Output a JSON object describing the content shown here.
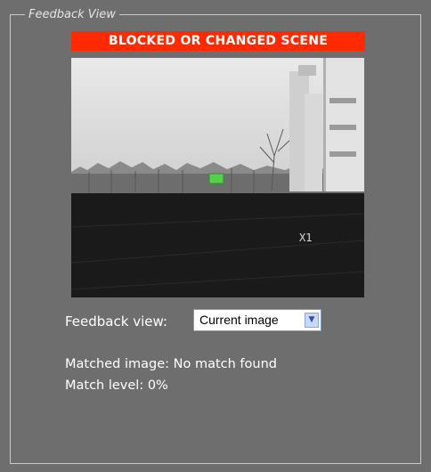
{
  "panel": {
    "legend": "Feedback View",
    "banner": "BLOCKED OR CHANGED SCENE",
    "camera_overlay": "X1",
    "feedback_view_label": "Feedback view:",
    "feedback_view_selected": "Current image",
    "matched_image_label": "Matched image:",
    "matched_image_value": "No match found",
    "match_level_label": "Match level:",
    "match_level_value": "0%"
  },
  "colors": {
    "panel_bg": "#6e6e6e",
    "banner_bg": "#ff2a00",
    "marker": "#55d04a"
  },
  "icons": {
    "dropdown": "chevron-down-icon"
  }
}
